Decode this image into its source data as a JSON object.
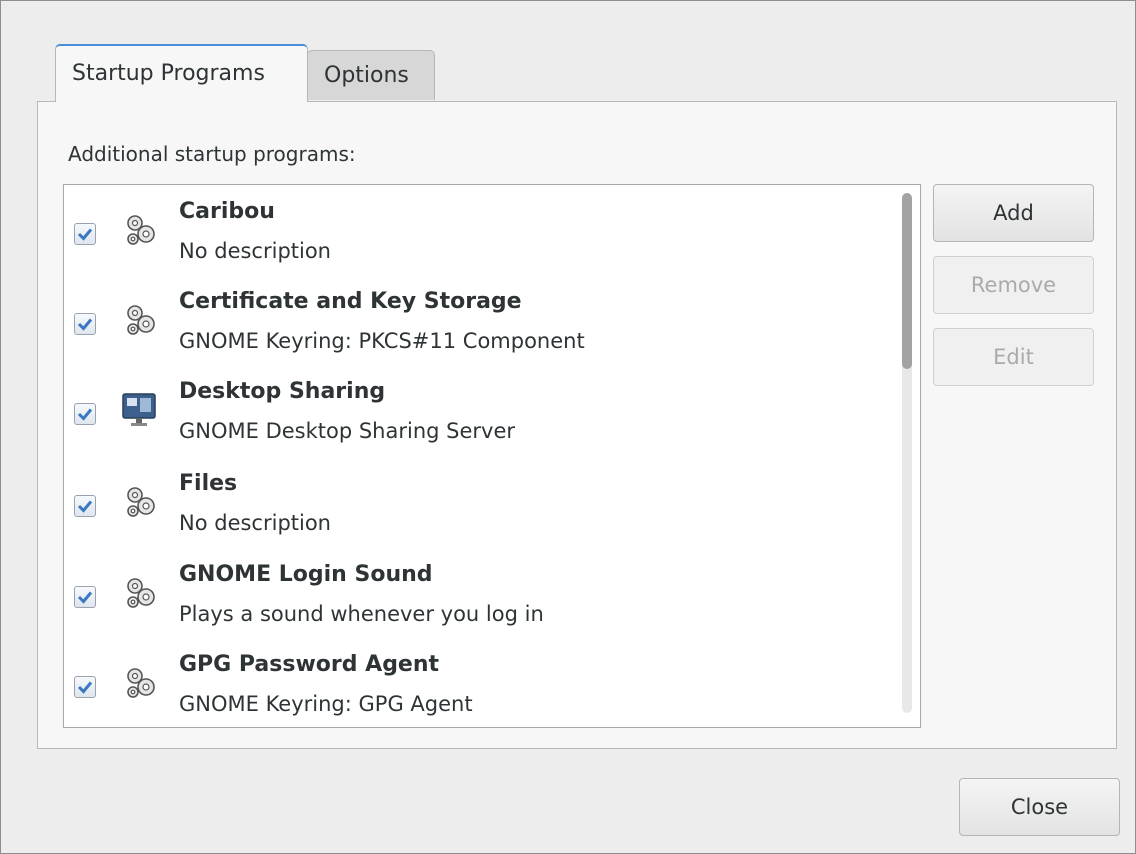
{
  "tabs": [
    {
      "label": "Startup Programs",
      "active": true
    },
    {
      "label": "Options",
      "active": false
    }
  ],
  "section_label": "Additional startup programs:",
  "programs": [
    {
      "name": "Caribou",
      "description": "No description",
      "enabled": true,
      "icon": "gears-icon"
    },
    {
      "name": "Certificate and Key Storage",
      "description": "GNOME Keyring: PKCS#11 Component",
      "enabled": true,
      "icon": "gears-icon"
    },
    {
      "name": "Desktop Sharing",
      "description": "GNOME Desktop Sharing Server",
      "enabled": true,
      "icon": "desktop-sharing-icon"
    },
    {
      "name": "Files",
      "description": "No description",
      "enabled": true,
      "icon": "gears-icon"
    },
    {
      "name": "GNOME Login Sound",
      "description": "Plays a sound whenever you log in",
      "enabled": true,
      "icon": "gears-icon"
    },
    {
      "name": "GPG Password Agent",
      "description": "GNOME Keyring: GPG Agent",
      "enabled": true,
      "icon": "gears-icon"
    }
  ],
  "buttons": {
    "add": "Add",
    "remove": "Remove",
    "edit": "Edit",
    "close": "Close"
  },
  "colors": {
    "tab_accent": "#4a90d9",
    "check_mark": "#3b78c3"
  }
}
